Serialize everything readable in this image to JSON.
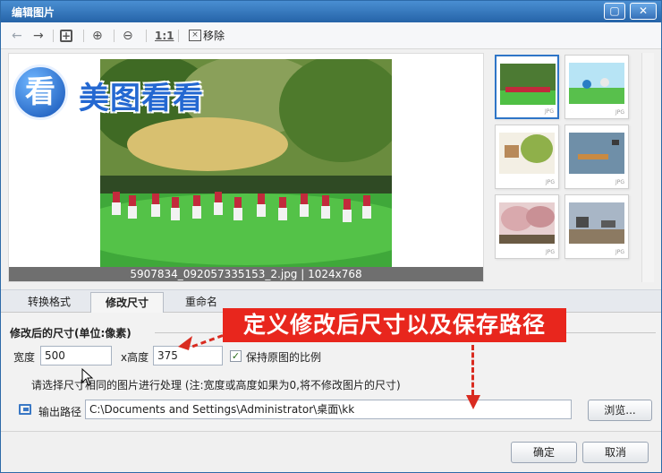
{
  "window": {
    "title": "编辑图片"
  },
  "toolbar": {
    "ratio_label": "1:1",
    "remove_label": "移除"
  },
  "preview": {
    "logo_char": "看",
    "logo_text": "美图看看",
    "caption": "5907834_092057335153_2.jpg | 1024x768"
  },
  "thumbnails": [
    {
      "format": "JPG"
    },
    {
      "format": "JPG"
    },
    {
      "format": "JPG"
    },
    {
      "format": "JPG"
    },
    {
      "format": "JPG"
    },
    {
      "format": "JPG"
    }
  ],
  "tabs": [
    {
      "label": "转换格式"
    },
    {
      "label": "修改尺寸"
    },
    {
      "label": "重命名"
    }
  ],
  "resize": {
    "section_title": "修改后的尺寸(单位:像素)",
    "width_label": "宽度",
    "width_value": "500",
    "height_label": "x高度",
    "height_value": "375",
    "keep_ratio_label": "保持原图的比例",
    "keep_ratio_checked": true,
    "hint": "请选择尺寸相同的图片进行处理 (注:宽度或高度如果为0,将不修改图片的尺寸)",
    "output_label": "输出路径",
    "output_path": "C:\\Documents and Settings\\Administrator\\桌面\\kk",
    "browse_label": "浏览..."
  },
  "annotation": {
    "text": "定义修改后尺寸以及保存路径"
  },
  "footer": {
    "ok_label": "确定",
    "cancel_label": "取消"
  },
  "colors": {
    "title_bar": "#2563a8",
    "annotation": "#e8261d",
    "selected_thumb": "#2e75c7"
  }
}
